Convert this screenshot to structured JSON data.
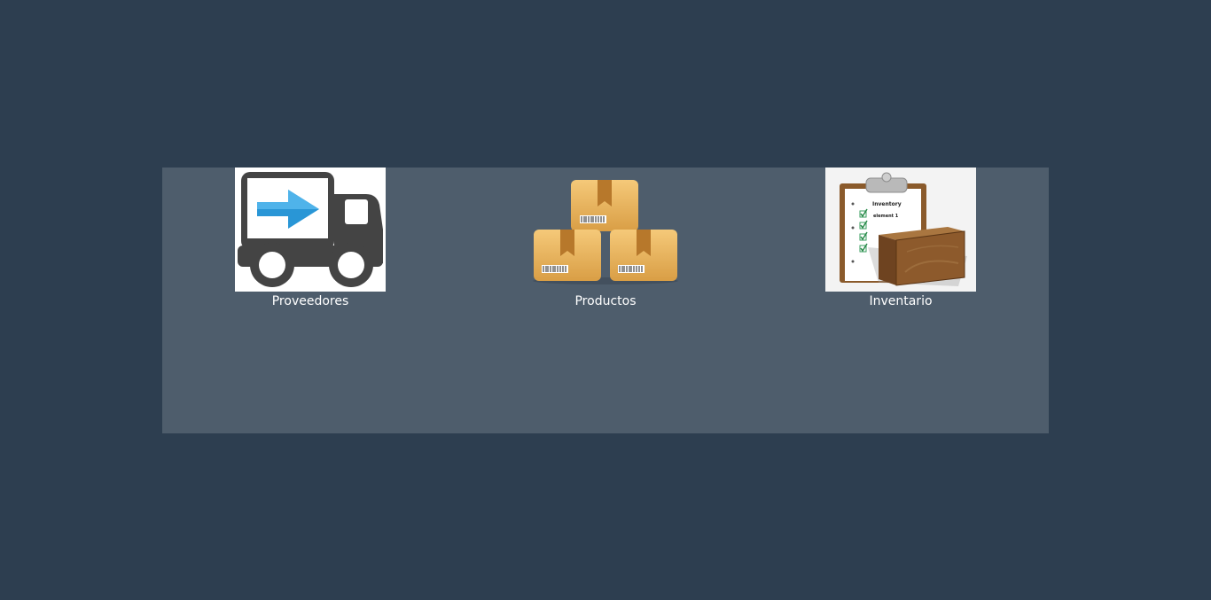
{
  "colors": {
    "page_background": "#2d3e50",
    "panel_background": "#4e5d6c",
    "label_text": "#ffffff"
  },
  "menu": {
    "items": [
      {
        "label": "Proveedores",
        "icon": "delivery-truck-icon"
      },
      {
        "label": "Productos",
        "icon": "stacked-boxes-icon"
      },
      {
        "label": "Inventario",
        "icon": "inventory-clipboard-icon"
      }
    ]
  },
  "inventory_image": {
    "title": "Inventory",
    "line1": "element 1"
  }
}
